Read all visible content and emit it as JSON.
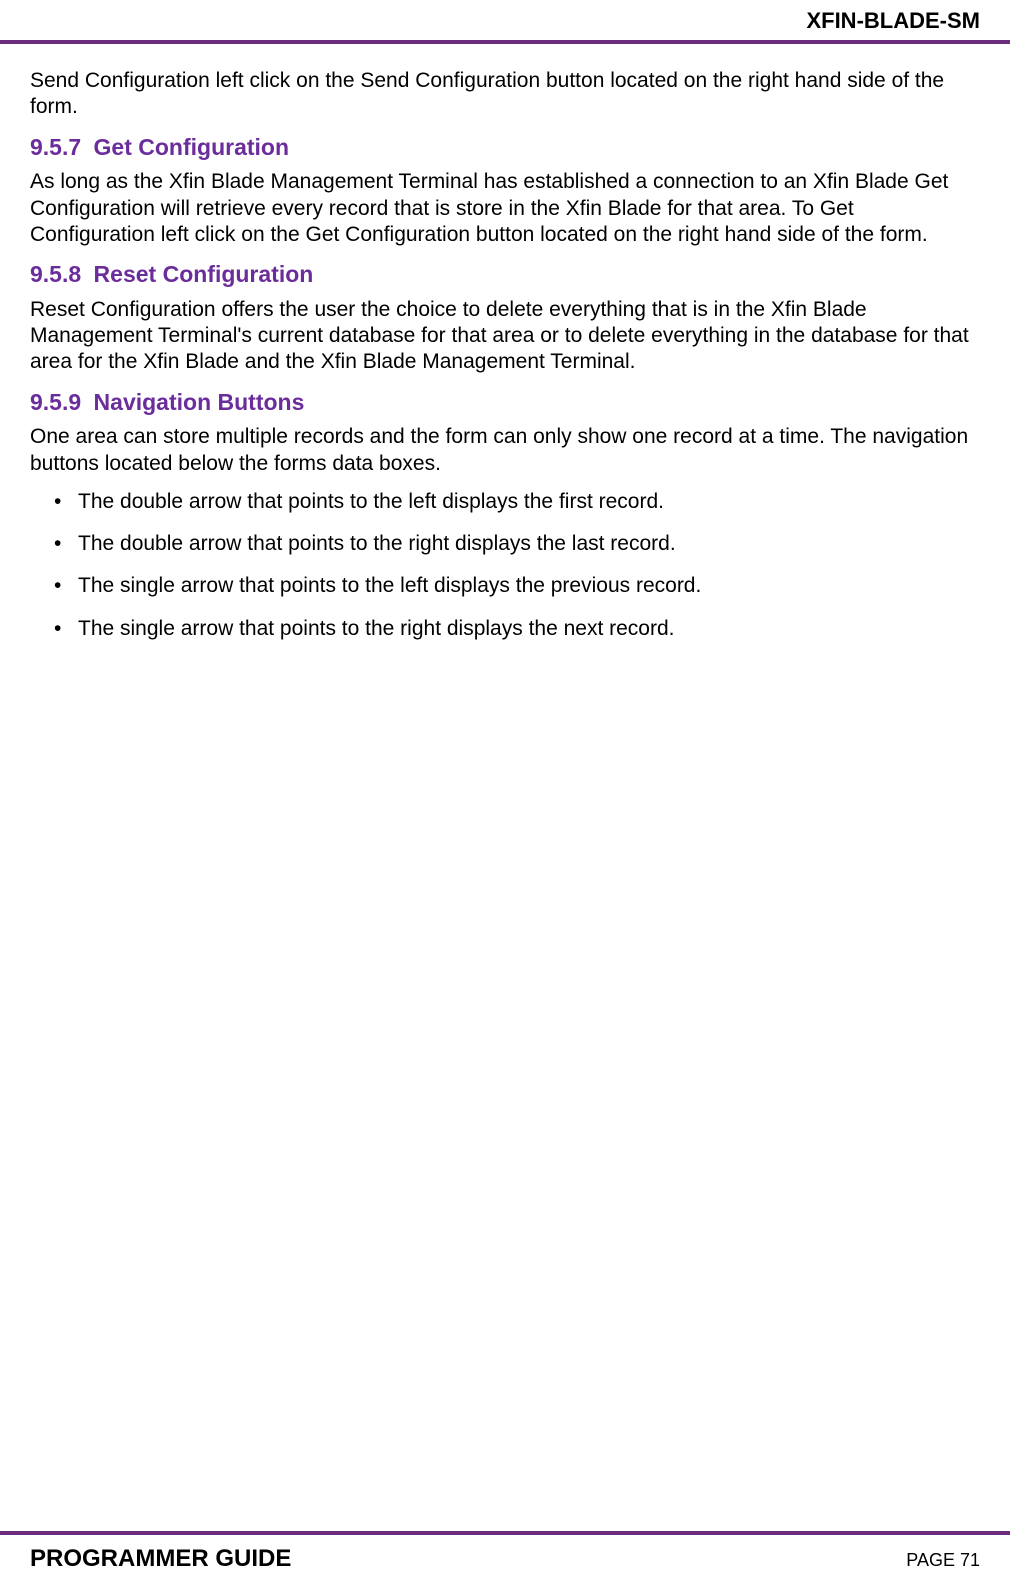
{
  "header": {
    "title": "XFIN-BLADE-SM"
  },
  "body": {
    "intro_para": "Send Configuration left click on the Send Configuration button located on the right hand side of the form.",
    "s957": {
      "num": "9.5.7",
      "title": "Get Configuration",
      "para": "As long as the Xfin Blade Management Terminal has established a connection to an Xfin Blade Get Configuration will retrieve every record that is store in the Xfin Blade for that area. To Get Configuration left click on the Get Configuration button located on the right hand side of the form."
    },
    "s958": {
      "num": "9.5.8",
      "title": "Reset Configuration",
      "para": "Reset Configuration offers the user the choice to delete everything that is in the Xfin Blade Management Terminal's current database for that area or to delete everything in the database for that area for the Xfin Blade and the Xfin Blade Management Terminal."
    },
    "s959": {
      "num": "9.5.9",
      "title": "Navigation Buttons",
      "para": "One area can store multiple records and the form can only show one record at a time. The navigation buttons located below the forms data boxes.",
      "bullets": [
        "The double arrow that points to the left displays the first record.",
        "The double arrow that points to the right displays the last record.",
        "The single arrow that points to the left displays the previous record.",
        "The single arrow that points to the right displays the next record."
      ]
    }
  },
  "footer": {
    "left": "PROGRAMMER GUIDE",
    "right": "PAGE 71"
  }
}
